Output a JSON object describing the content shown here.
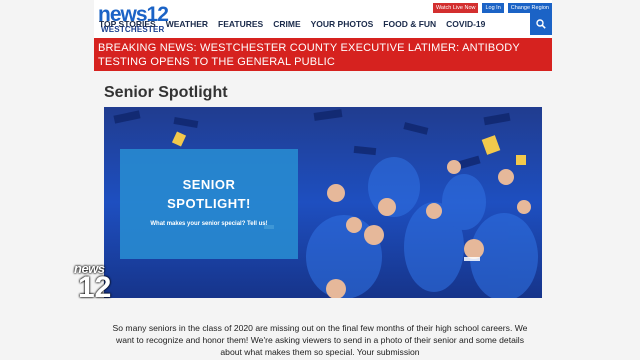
{
  "header": {
    "logo_main": "news12",
    "logo_sub": "WESTCHESTER",
    "top_links": [
      "Watch Live Now",
      "Log In",
      "Change Region"
    ],
    "nav": [
      "TOP STORIES",
      "WEATHER",
      "FEATURES",
      "CRIME",
      "YOUR PHOTOS",
      "FOOD & FUN",
      "COVID-19"
    ],
    "search_icon": "search-icon"
  },
  "breaking": {
    "text": "BREAKING NEWS: WESTCHESTER COUNTY EXECUTIVE LATIMER: ANTIBODY TESTING OPENS TO THE GENERAL PUBLIC"
  },
  "page": {
    "title": "Senior Spotlight"
  },
  "hero": {
    "overlay_title_line1": "SENIOR",
    "overlay_title_line2": "SPOTLIGHT!",
    "overlay_sub": "What makes your senior special? Tell us!"
  },
  "watermark": {
    "news": "news",
    "number": "12"
  },
  "body": {
    "text": "So many seniors in the class of 2020 are missing out on the final few months of their high school careers. We want to recognize and honor them! We're asking viewers to send in a photo of their senior and some details about what makes them so special. Your submission"
  },
  "colors": {
    "brand_blue": "#1b63c6",
    "breaking_red": "#d6221f",
    "overlay_blue": "#288cd2"
  }
}
